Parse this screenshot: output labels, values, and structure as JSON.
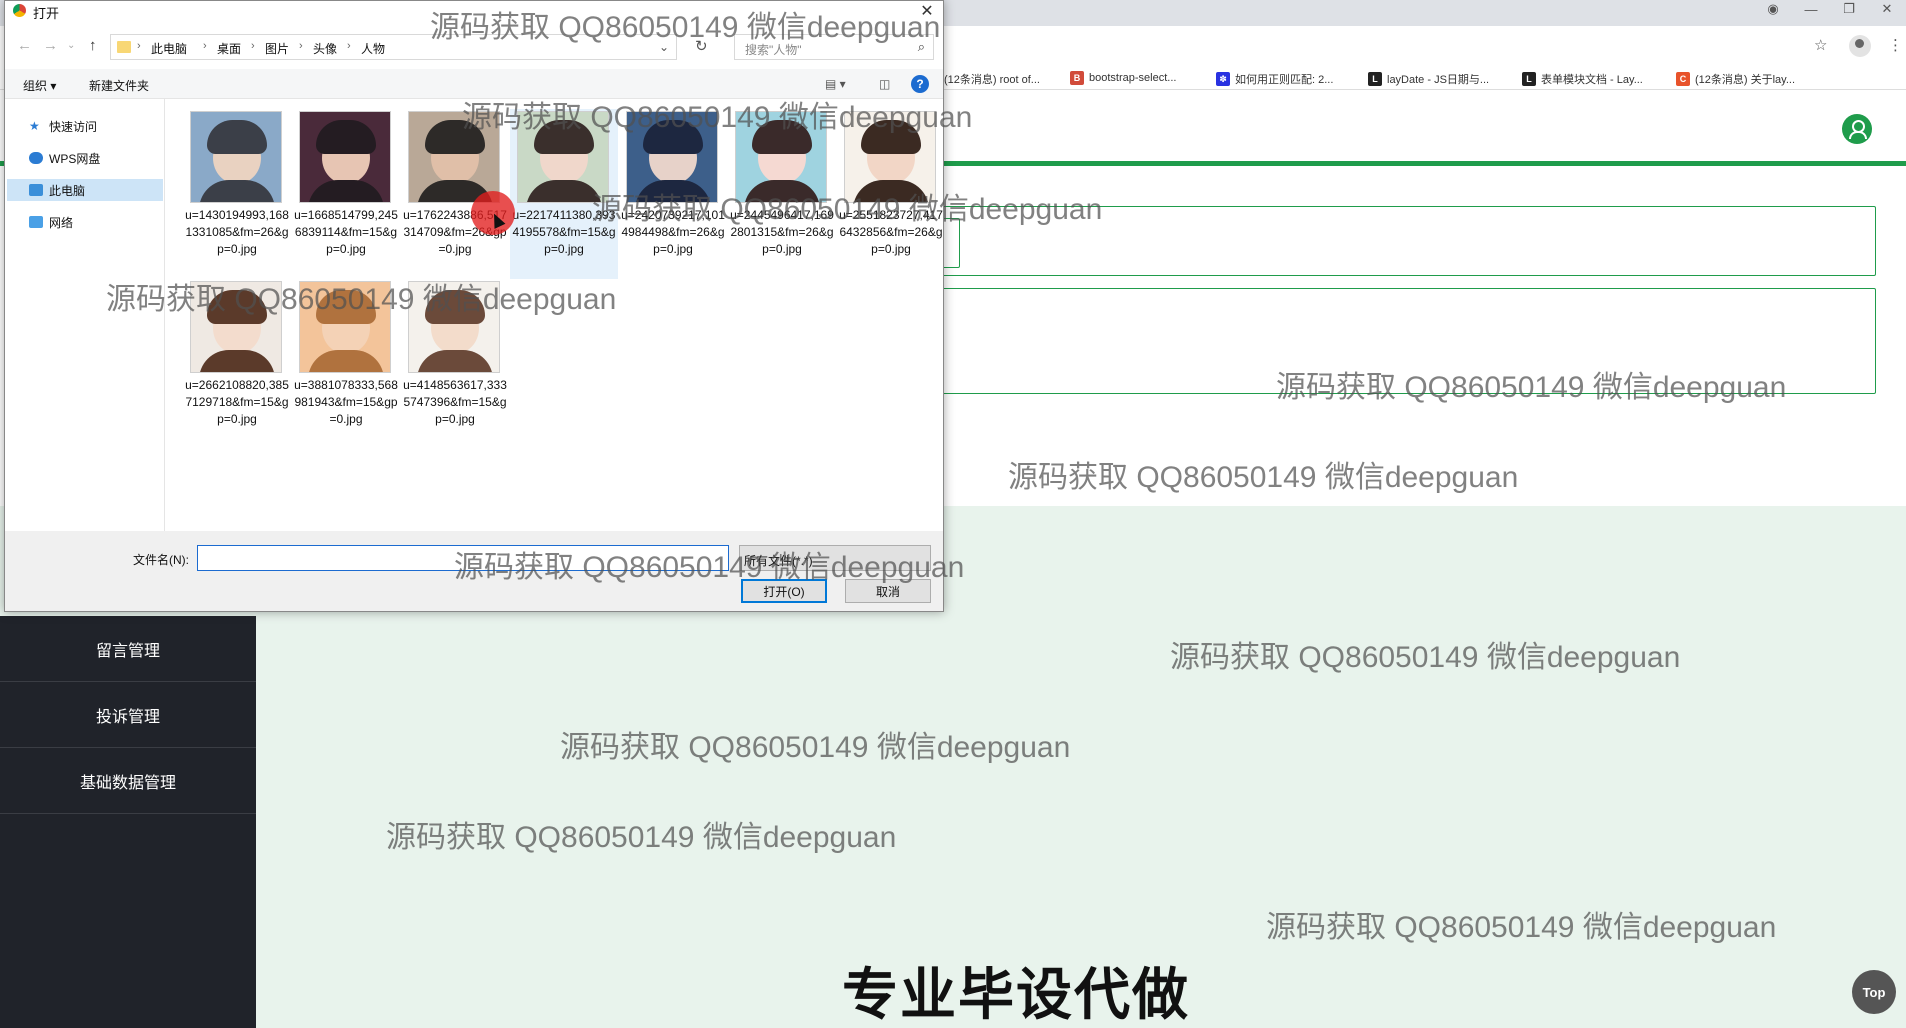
{
  "dialog": {
    "title": "打开",
    "close": "✕",
    "breadcrumbs": [
      "此电脑",
      "桌面",
      "图片",
      "头像",
      "人物"
    ],
    "search_placeholder": "搜索\"人物\"",
    "organize_label": "组织 ▾",
    "new_folder_label": "新建文件夹",
    "nav_items": [
      {
        "label": "快速访问",
        "icon": "star-icon"
      },
      {
        "label": "WPS网盘",
        "icon": "cloud-icon"
      },
      {
        "label": "此电脑",
        "icon": "computer-icon"
      },
      {
        "label": "网络",
        "icon": "network-icon"
      }
    ],
    "files": [
      {
        "name": "u=1430194993,1681331085&fm=26&gp=0.jpg",
        "thumb_colors": [
          "#8aa9c8",
          "#3b3f48",
          "#e9d2c1"
        ]
      },
      {
        "name": "u=1668514799,2456839114&fm=15&gp=0.jpg",
        "thumb_colors": [
          "#4a2a3a",
          "#241c22",
          "#e7c5b3"
        ]
      },
      {
        "name": "u=1762243886,517314709&fm=26&gp=0.jpg",
        "thumb_colors": [
          "#b9a897",
          "#2d2a28",
          "#e0bfa8"
        ]
      },
      {
        "name": "u=2217411380,3934195578&fm=15&gp=0.jpg",
        "thumb_colors": [
          "#c9d9c6",
          "#3a2f2c",
          "#f0d7cb"
        ]
      },
      {
        "name": "u=2420739217,1014984498&fm=26&gp=0.jpg",
        "thumb_colors": [
          "#3d5f8a",
          "#1d2740",
          "#e7d2c9"
        ]
      },
      {
        "name": "u=2445496417,1692801315&fm=26&gp=0.jpg",
        "thumb_colors": [
          "#9fd3e0",
          "#3a2a2a",
          "#f5d9d2"
        ]
      },
      {
        "name": "u=2551823727,4176432856&fm=26&gp=0.jpg",
        "thumb_colors": [
          "#f6f1ea",
          "#3b2a22",
          "#f2d6c6"
        ]
      },
      {
        "name": "u=2662108820,3857129718&fm=15&gp=0.jpg",
        "thumb_colors": [
          "#efe9e3",
          "#5b3a2a",
          "#f3dccd"
        ]
      },
      {
        "name": "u=3881078333,568981943&fm=15&gp=0.jpg",
        "thumb_colors": [
          "#f3c49a",
          "#b0723e",
          "#f4d2b6"
        ]
      },
      {
        "name": "u=4148563617,3335747396&fm=15&gp=0.jpg",
        "thumb_colors": [
          "#f4f1ec",
          "#6b4a3a",
          "#f3dccb"
        ]
      }
    ],
    "selected_file_index": 3,
    "filename_label": "文件名(N):",
    "filename_value": "",
    "filter_label": "所有文件(*.*)",
    "open_label": "打开(O)",
    "cancel_label": "取消"
  },
  "browser": {
    "bookmarks": [
      {
        "label": "(12条消息) root of...",
        "icon": "csdn-icon",
        "color": "#c8393b"
      },
      {
        "label": "bootstrap-select...",
        "icon": "bootstrap-icon",
        "color": "#d14b3a"
      },
      {
        "label": "如何用正则匹配: 2...",
        "icon": "baidu-icon",
        "color": "#2932e1"
      },
      {
        "label": "layDate - JS日期与...",
        "icon": "layui-icon",
        "color": "#222222"
      },
      {
        "label": "表单模块文档 - Lay...",
        "icon": "layui-icon",
        "color": "#222222"
      },
      {
        "label": "(12条消息) 关于lay...",
        "icon": "csdn-icon",
        "color": "#e8532b"
      }
    ]
  },
  "app": {
    "menu": [
      "留言管理",
      "投诉管理",
      "基础数据管理"
    ],
    "top_button": "Top",
    "banner": "专业毕设代做",
    "accent": "#1f9c4b"
  },
  "watermark": "源码获取 QQ86050149 微信deepguan"
}
